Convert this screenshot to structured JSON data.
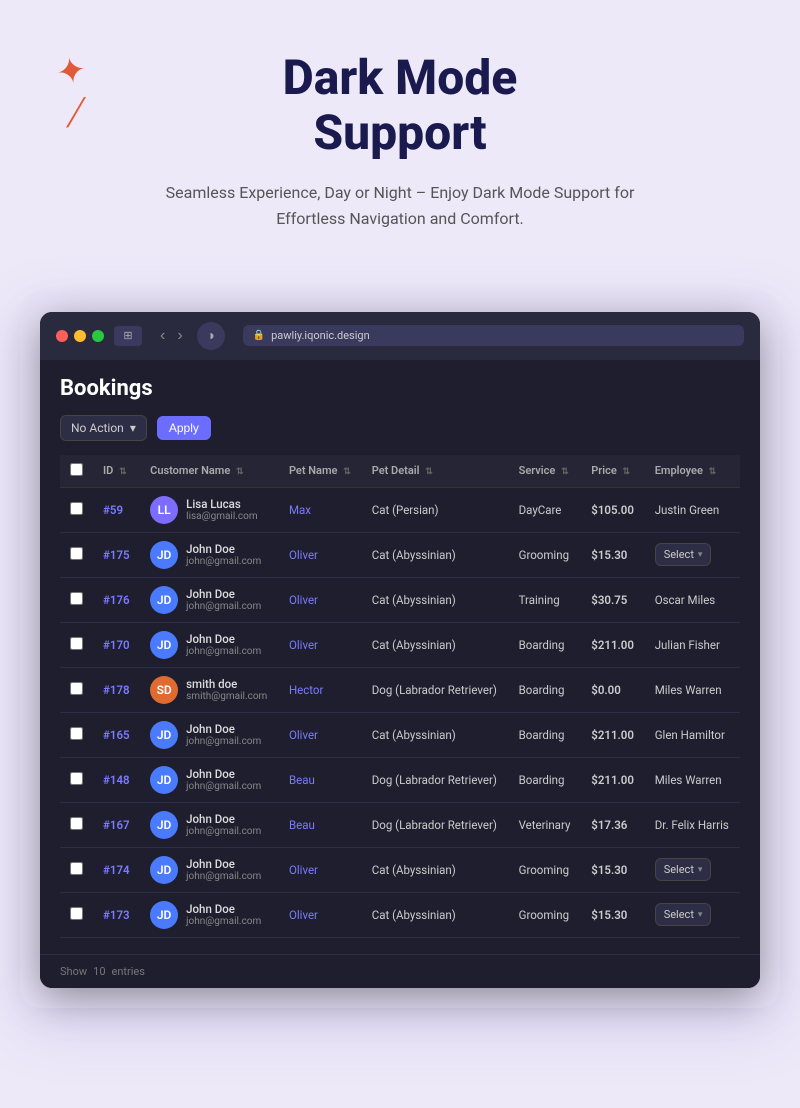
{
  "page": {
    "background_color": "#ede9f8"
  },
  "header": {
    "title_line1": "Dark Mode",
    "title_line2": "Support",
    "subtitle": "Seamless Experience, Day or Night – Enjoy Dark Mode Support for Effortless Navigation and Comfort."
  },
  "browser": {
    "url": "pawliy.iqonic.design",
    "dots": [
      "red",
      "yellow",
      "green"
    ]
  },
  "bookings": {
    "title": "Bookings",
    "toolbar": {
      "action_label": "No Action",
      "apply_label": "Apply"
    },
    "columns": [
      "",
      "ID",
      "Customer Name",
      "Pet Name",
      "Pet Detail",
      "Service",
      "Price",
      "Employee"
    ],
    "rows": [
      {
        "id": "#59",
        "customer_name": "Lisa Lucas",
        "customer_email": "lisa@gmail.com",
        "avatar_initials": "LL",
        "avatar_class": "av-purple",
        "pet_name": "Max",
        "pet_detail": "Cat (Persian)",
        "service": "DayCare",
        "price": "$105.00",
        "employee": "Justin Green",
        "employee_type": "text"
      },
      {
        "id": "#175",
        "customer_name": "John Doe",
        "customer_email": "john@gmail.com",
        "avatar_initials": "JD",
        "avatar_class": "av-blue",
        "pet_name": "Oliver",
        "pet_detail": "Cat (Abyssinian)",
        "service": "Grooming",
        "price": "$15.30",
        "employee": "Select",
        "employee_type": "select"
      },
      {
        "id": "#176",
        "customer_name": "John Doe",
        "customer_email": "john@gmail.com",
        "avatar_initials": "JD",
        "avatar_class": "av-blue",
        "pet_name": "Oliver",
        "pet_detail": "Cat (Abyssinian)",
        "service": "Training",
        "price": "$30.75",
        "employee": "Oscar Miles",
        "employee_type": "text"
      },
      {
        "id": "#170",
        "customer_name": "John Doe",
        "customer_email": "john@gmail.com",
        "avatar_initials": "JD",
        "avatar_class": "av-blue",
        "pet_name": "Oliver",
        "pet_detail": "Cat (Abyssinian)",
        "service": "Boarding",
        "price": "$211.00",
        "employee": "Julian Fisher",
        "employee_type": "text"
      },
      {
        "id": "#178",
        "customer_name": "smith doe",
        "customer_email": "smith@gmail.com",
        "avatar_initials": "SD",
        "avatar_class": "av-orange",
        "pet_name": "Hector",
        "pet_detail": "Dog (Labrador Retriever)",
        "service": "Boarding",
        "price": "$0.00",
        "employee": "Miles Warren",
        "employee_type": "text"
      },
      {
        "id": "#165",
        "customer_name": "John Doe",
        "customer_email": "john@gmail.com",
        "avatar_initials": "JD",
        "avatar_class": "av-blue",
        "pet_name": "Oliver",
        "pet_detail": "Cat (Abyssinian)",
        "service": "Boarding",
        "price": "$211.00",
        "employee": "Glen Hamiltor",
        "employee_type": "text"
      },
      {
        "id": "#148",
        "customer_name": "John Doe",
        "customer_email": "john@gmail.com",
        "avatar_initials": "JD",
        "avatar_class": "av-blue",
        "pet_name": "Beau",
        "pet_detail": "Dog (Labrador Retriever)",
        "service": "Boarding",
        "price": "$211.00",
        "employee": "Miles Warren",
        "employee_type": "text"
      },
      {
        "id": "#167",
        "customer_name": "John Doe",
        "customer_email": "john@gmail.com",
        "avatar_initials": "JD",
        "avatar_class": "av-blue",
        "pet_name": "Beau",
        "pet_detail": "Dog (Labrador Retriever)",
        "service": "Veterinary",
        "price": "$17.36",
        "employee": "Dr. Felix Harris",
        "employee_type": "text"
      },
      {
        "id": "#174",
        "customer_name": "John Doe",
        "customer_email": "john@gmail.com",
        "avatar_initials": "JD",
        "avatar_class": "av-blue",
        "pet_name": "Oliver",
        "pet_detail": "Cat (Abyssinian)",
        "service": "Grooming",
        "price": "$15.30",
        "employee": "Select",
        "employee_type": "select"
      },
      {
        "id": "#173",
        "customer_name": "John Doe",
        "customer_email": "john@gmail.com",
        "avatar_initials": "JD",
        "avatar_class": "av-blue",
        "pet_name": "Oliver",
        "pet_detail": "Cat (Abyssinian)",
        "service": "Grooming",
        "price": "$15.30",
        "employee": "Select",
        "employee_type": "select"
      }
    ],
    "footer": {
      "show_label": "Show",
      "entries_label": "10",
      "entries_suffix": "entries"
    }
  }
}
